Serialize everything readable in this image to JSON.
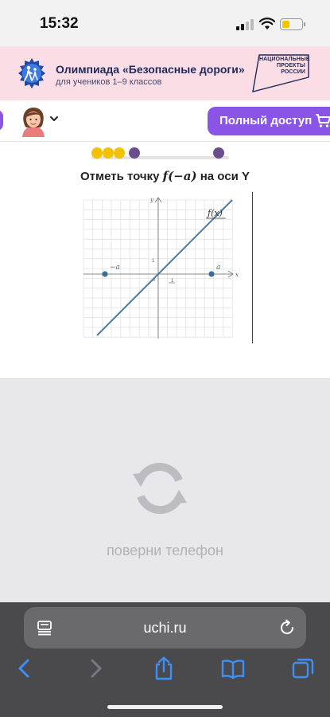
{
  "status_bar": {
    "time": "15:32"
  },
  "banner": {
    "title": "Олимпиада «Безопасные дороги»",
    "subtitle": "для учеников 1–9 классов",
    "partner_logo_text": "НАЦИОНАЛЬНЫЕ ПРОЕКТЫ РОССИИ"
  },
  "header": {
    "full_access_label": "Полный доступ"
  },
  "progress": {
    "dots": [
      {
        "state": "done",
        "color": "#f2c200"
      },
      {
        "state": "done",
        "color": "#f2c200"
      },
      {
        "state": "done",
        "color": "#f2c200"
      },
      {
        "state": "current",
        "color": "#6a4d8c"
      },
      {
        "state": "final",
        "color": "#6a4d8c"
      }
    ]
  },
  "task": {
    "title_prefix": "Отметь точку ",
    "title_expr": "f(−a)",
    "title_suffix": " на оси Y"
  },
  "graph": {
    "y_axis_label": "y",
    "x_axis_label": "x",
    "zero_label": "0",
    "unit_x_label": "1",
    "unit_y_label": "1",
    "function_label": "f(x)",
    "point_left_label": "−a",
    "point_right_label": "a",
    "line_color": "#4a7aa6",
    "point_color": "#3c6e9a"
  },
  "rotate": {
    "message": "поверни телефон"
  },
  "browser": {
    "url": "uchi.ru"
  }
}
